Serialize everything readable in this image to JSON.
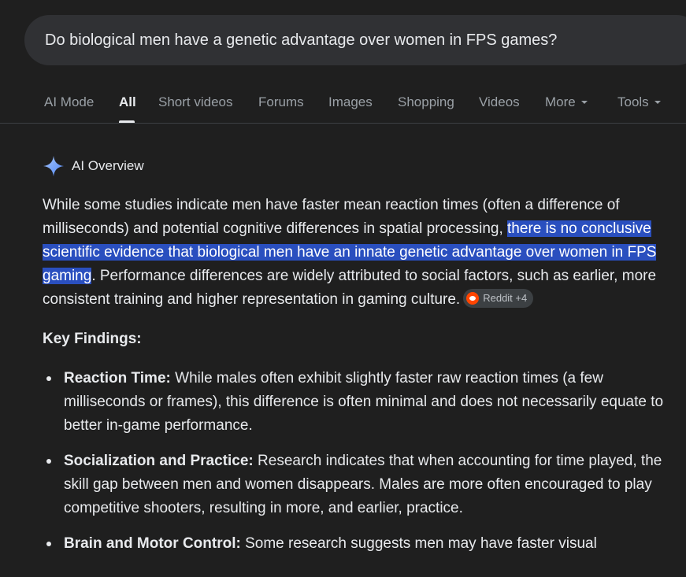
{
  "search": {
    "query": "Do biological men have a genetic advantage over women in FPS games?"
  },
  "tabs": [
    {
      "label": "AI Mode",
      "active": false
    },
    {
      "label": "All",
      "active": true
    },
    {
      "label": "Short videos",
      "active": false
    },
    {
      "label": "Forums",
      "active": false
    },
    {
      "label": "Images",
      "active": false
    },
    {
      "label": "Shopping",
      "active": false
    },
    {
      "label": "Videos",
      "active": false
    },
    {
      "label": "More",
      "active": false
    },
    {
      "label": "Tools",
      "active": false
    }
  ],
  "ai_overview": {
    "title": "AI Overview",
    "icon": "sparkle-icon",
    "accent_color": "#8ab4f8",
    "highlight_color": "#2a4fbf",
    "intro_before": "While some studies indicate men have faster mean reaction times (often a difference of milliseconds) and potential cognitive differences in spatial processing, ",
    "intro_highlight": "there is no conclusive scientific evidence that biological men have an innate genetic advantage over women in FPS gaming",
    "intro_after": ". Performance differences are widely attributed to social factors, such as earlier, more consistent training and higher representation in gaming culture.",
    "source_chip": {
      "icon": "reddit-icon",
      "label": "Reddit +4"
    },
    "key_findings_title": "Key Findings:",
    "findings": [
      {
        "term": "Reaction Time:",
        "text": " While males often exhibit slightly faster raw reaction times (a few milliseconds or frames), this difference is often minimal and does not necessarily equate to better in-game performance."
      },
      {
        "term": "Socialization and Practice:",
        "text": " Research indicates that when accounting for time played, the skill gap between men and women disappears. Males are more often encouraged to play competitive shooters, resulting in more, and earlier, practice."
      },
      {
        "term": "Brain and Motor Control:",
        "text": " Some research suggests men may have faster visual"
      }
    ]
  }
}
